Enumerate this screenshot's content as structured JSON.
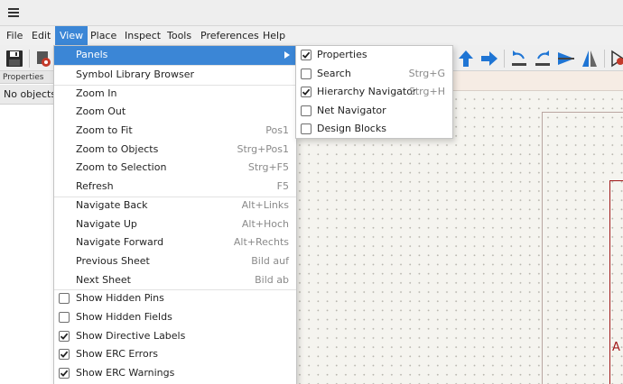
{
  "menubar": {
    "items": [
      "File",
      "Edit",
      "View",
      "Place",
      "Inspect",
      "Tools",
      "Preferences",
      "Help"
    ],
    "active": "View"
  },
  "properties_panel": {
    "title": "Properties",
    "empty_text": "No objects selected"
  },
  "canvas": {
    "sheet_letter": "A"
  },
  "view_menu": {
    "items": [
      {
        "label": "Panels",
        "shortcut": "",
        "submenu": true,
        "highlighted": true
      },
      {
        "label": "Symbol Library Browser",
        "shortcut": ""
      },
      {
        "label": "Zoom In",
        "shortcut": ""
      },
      {
        "label": "Zoom Out",
        "shortcut": ""
      },
      {
        "label": "Zoom to Fit",
        "shortcut": "Pos1"
      },
      {
        "label": "Zoom to Objects",
        "shortcut": "Strg+Pos1"
      },
      {
        "label": "Zoom to Selection",
        "shortcut": "Strg+F5"
      },
      {
        "label": "Refresh",
        "shortcut": "F5"
      },
      {
        "label": "Navigate Back",
        "shortcut": "Alt+Links"
      },
      {
        "label": "Navigate Up",
        "shortcut": "Alt+Hoch"
      },
      {
        "label": "Navigate Forward",
        "shortcut": "Alt+Rechts"
      },
      {
        "label": "Previous Sheet",
        "shortcut": "Bild auf"
      },
      {
        "label": "Next Sheet",
        "shortcut": "Bild ab"
      },
      {
        "label": "Show Hidden Pins",
        "checked": false
      },
      {
        "label": "Show Hidden Fields",
        "checked": false
      },
      {
        "label": "Show Directive Labels",
        "checked": true
      },
      {
        "label": "Show ERC Errors",
        "checked": true
      },
      {
        "label": "Show ERC Warnings",
        "checked": true
      }
    ]
  },
  "panels_menu": {
    "items": [
      {
        "label": "Properties",
        "shortcut": "",
        "checked": true
      },
      {
        "label": "Search",
        "shortcut": "Strg+G",
        "checked": false
      },
      {
        "label": "Hierarchy Navigator",
        "shortcut": "Strg+H",
        "checked": true
      },
      {
        "label": "Net Navigator",
        "shortcut": "",
        "checked": false
      },
      {
        "label": "Design Blocks",
        "shortcut": "",
        "checked": false
      }
    ]
  },
  "toolbar": {
    "icons": [
      "save-icon",
      "schematic-setup-icon",
      "arrow-up-icon",
      "arrow-right-icon",
      "rotate-ccw-icon",
      "rotate-cw-icon",
      "mirror-vertical-icon",
      "mirror-horizontal-icon",
      "symbol-editor-icon"
    ]
  },
  "colors": {
    "accent": "#3b86d6",
    "toolbar_blue": "#1f75d4",
    "canvas_bg": "#f5f4ef",
    "sheet_border": "#a01818"
  }
}
